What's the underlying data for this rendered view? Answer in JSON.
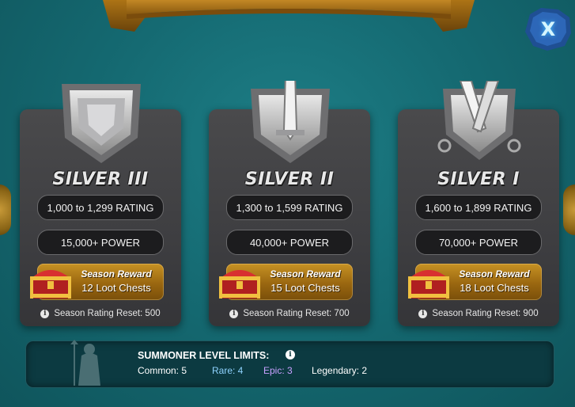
{
  "close_label": "X",
  "tiers": [
    {
      "name": "SILVER III",
      "rating": "1,000 to 1,299 RATING",
      "power": "15,000+ POWER",
      "reward_title": "Season Reward",
      "reward_value": "12 Loot Chests",
      "reset": "Season Rating Reset: 500"
    },
    {
      "name": "SILVER II",
      "rating": "1,300 to 1,599 RATING",
      "power": "40,000+ POWER",
      "reward_title": "Season Reward",
      "reward_value": "15 Loot Chests",
      "reset": "Season Rating Reset: 700"
    },
    {
      "name": "SILVER I",
      "rating": "1,600 to 1,899 RATING",
      "power": "70,000+ POWER",
      "reward_title": "Season Reward",
      "reward_value": "18 Loot Chests",
      "reset": "Season Rating Reset: 900"
    }
  ],
  "limits": {
    "title": "SUMMONER LEVEL LIMITS:",
    "items": [
      {
        "label": "Common: 5",
        "color": "#ffffff"
      },
      {
        "label": "Rare: 4",
        "color": "#8fd3ff"
      },
      {
        "label": "Epic: 3",
        "color": "#c8a0ff"
      },
      {
        "label": "Legendary: 2",
        "color": "#ffffff"
      }
    ]
  },
  "colors": {
    "background": "#156a72",
    "card": "#3e3e41",
    "reward_gold": "#b07e1c",
    "banner_gold": "#c8902a"
  },
  "icons": {
    "info": "info-circle-icon",
    "chest": "loot-chest-icon",
    "close": "close-icon"
  }
}
